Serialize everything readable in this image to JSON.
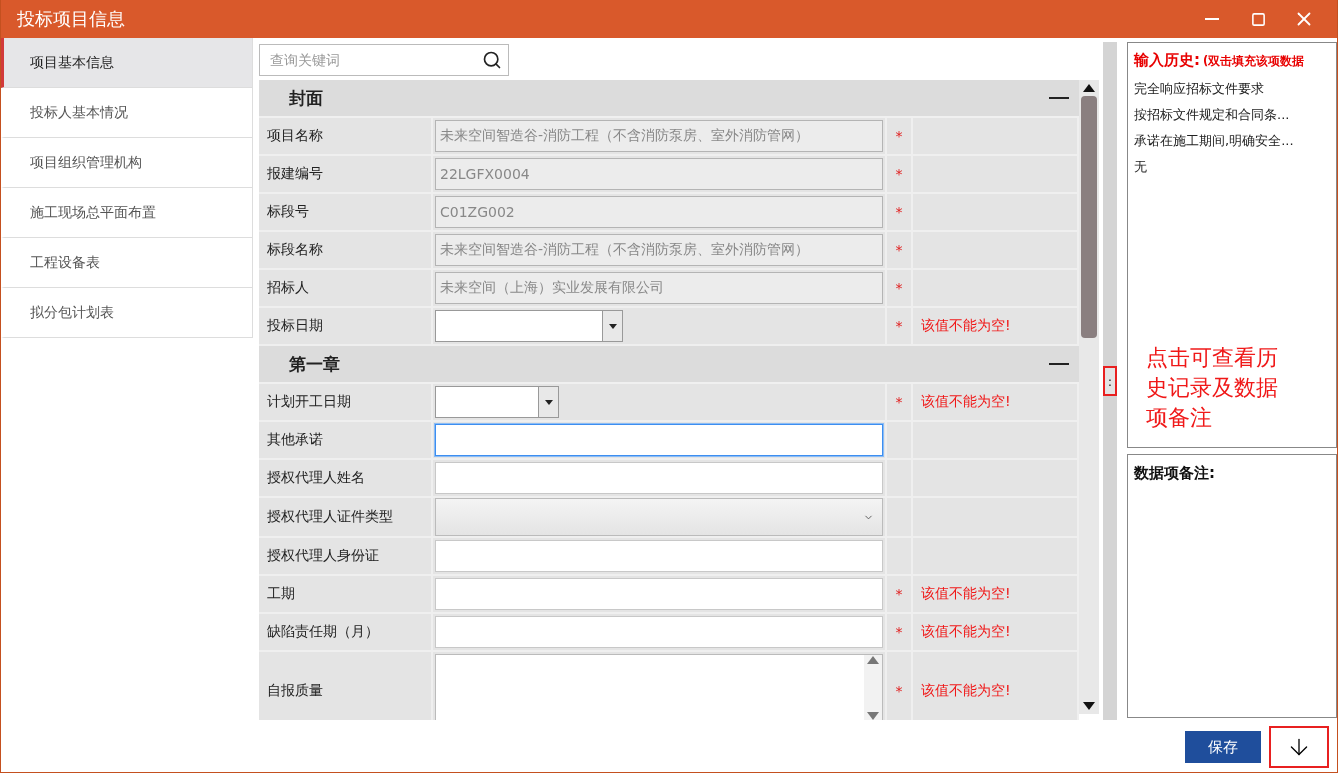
{
  "window": {
    "title": "投标项目信息"
  },
  "sidebar": {
    "items": [
      {
        "label": "项目基本信息",
        "selected": true
      },
      {
        "label": "投标人基本情况",
        "selected": false
      },
      {
        "label": "项目组织管理机构",
        "selected": false
      },
      {
        "label": "施工现场总平面布置",
        "selected": false
      },
      {
        "label": "工程设备表",
        "selected": false
      },
      {
        "label": "拟分包计划表",
        "selected": false
      }
    ]
  },
  "search": {
    "placeholder": "查询关键词"
  },
  "sections": [
    {
      "title": "封面",
      "expanded": true,
      "fields": [
        {
          "label": "项目名称",
          "kind": "text",
          "value": "未来空间智造谷-消防工程（不含消防泵房、室外消防管网）",
          "readonly": true,
          "focused": false,
          "required_mark": "*"
        },
        {
          "label": "报建编号",
          "kind": "text",
          "value": "22LGFX0004",
          "readonly": true,
          "focused": false,
          "required_mark": "*"
        },
        {
          "label": "标段号",
          "kind": "text",
          "value": "C01ZG002",
          "readonly": true,
          "focused": false,
          "required_mark": "*"
        },
        {
          "label": "标段名称",
          "kind": "text",
          "value": "未来空间智造谷-消防工程（不含消防泵房、室外消防管网）",
          "readonly": true,
          "focused": false,
          "required_mark": "*"
        },
        {
          "label": "招标人",
          "kind": "text",
          "value": "未来空间（上海）实业发展有限公司",
          "readonly": true,
          "focused": false,
          "required_mark": "*"
        },
        {
          "label": "投标日期",
          "kind": "date",
          "required_mark": "*",
          "error": "该值不能为空!"
        }
      ]
    },
    {
      "title": "第一章",
      "expanded": true,
      "fields": [
        {
          "label": "计划开工日期",
          "kind": "date",
          "required_mark": "*",
          "error": "该值不能为空!"
        },
        {
          "label": "其他承诺",
          "kind": "text",
          "readonly": false,
          "focused": true
        },
        {
          "label": "授权代理人姓名",
          "kind": "text",
          "readonly": false,
          "focused": false
        },
        {
          "label": "授权代理人证件类型",
          "kind": "select"
        },
        {
          "label": "授权代理人身份证",
          "kind": "text",
          "readonly": false,
          "focused": false
        },
        {
          "label": "工期",
          "kind": "text",
          "readonly": false,
          "focused": false,
          "required_mark": "*",
          "error": "该值不能为空!"
        },
        {
          "label": "缺陷责任期（月）",
          "kind": "text",
          "readonly": false,
          "focused": false,
          "required_mark": "*",
          "error": "该值不能为空!"
        },
        {
          "label": "自报质量",
          "kind": "textarea",
          "required_mark": "*",
          "error": "该值不能为空!"
        }
      ]
    }
  ],
  "history": {
    "title": "输入历史:",
    "hint": "(双击填充该项数据",
    "items": [
      "完全响应招标文件要求",
      "按招标文件规定和合同条...",
      "承诺在施工期间,明确安全...",
      "无"
    ]
  },
  "annotation": "点击可查看历史记录及数据项备注",
  "splitter_handle": ":",
  "remarks": {
    "title": "数据项备注:"
  },
  "footer": {
    "save": "保存"
  }
}
